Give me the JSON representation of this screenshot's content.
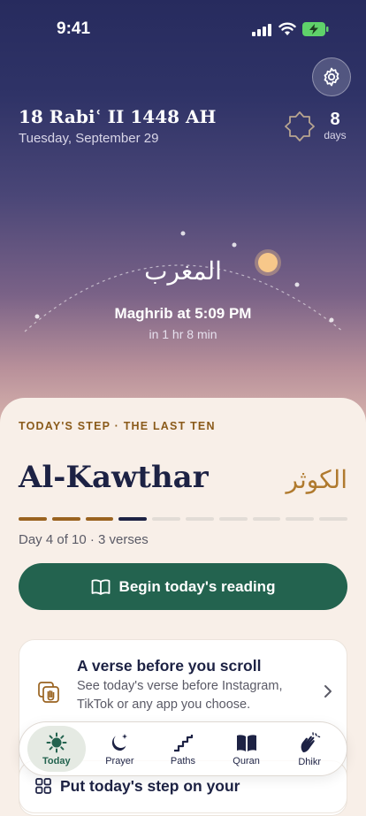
{
  "status": {
    "time": "9:41"
  },
  "header": {
    "hijri_date": "18 Rabiʿ II 1448 AH",
    "gregorian_date": "Tuesday, September 29",
    "countdown_value": "8",
    "countdown_unit": "days"
  },
  "prayer": {
    "arabic_name": "المغرب",
    "time_label": "Maghrib at 5:09 PM",
    "relative": "in 1 hr 8 min"
  },
  "step": {
    "label": "TODAY'S STEP · THE LAST TEN",
    "surah_name": "Al-Kawthar",
    "surah_arabic": "الكوثر",
    "progress": {
      "current_day": 4,
      "total_days": 10
    },
    "day_info": "Day 4 of 10 · 3 verses",
    "cta_label": "Begin today's reading"
  },
  "verse_card": {
    "title": "A verse before you scroll",
    "body": "See today's verse before Instagram, TikTok or any app you choose."
  },
  "widget_card": {
    "title": "Put today's step on your"
  },
  "tabs": [
    {
      "label": "Today",
      "icon": "sun-icon",
      "active": true
    },
    {
      "label": "Prayer",
      "icon": "moon-stars-icon",
      "active": false
    },
    {
      "label": "Paths",
      "icon": "stairs-icon",
      "active": false
    },
    {
      "label": "Quran",
      "icon": "book-icon",
      "active": false
    },
    {
      "label": "Dhikr",
      "icon": "hands-icon",
      "active": false
    }
  ],
  "colors": {
    "accent": "#23634f",
    "gold": "#9a6320",
    "navy": "#1d2244",
    "sun": "#f7c88a"
  }
}
